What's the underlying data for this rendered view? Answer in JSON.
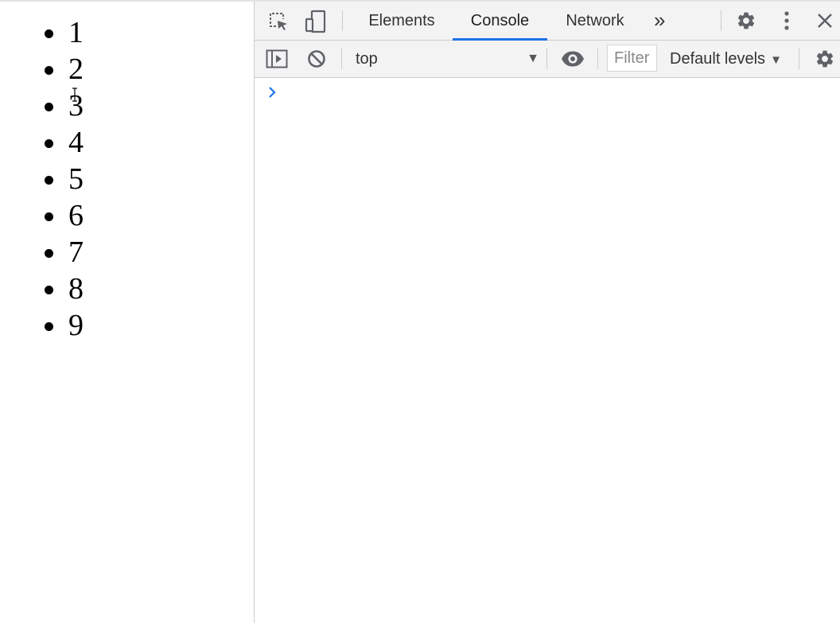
{
  "page": {
    "list_items": [
      "1",
      "2",
      "3",
      "4",
      "5",
      "6",
      "7",
      "8",
      "9"
    ]
  },
  "devtools": {
    "tabs": [
      {
        "label": "Elements",
        "active": false
      },
      {
        "label": "Console",
        "active": true
      },
      {
        "label": "Network",
        "active": false
      }
    ],
    "more_tabs_glyph": "»",
    "toolbar": {
      "context_value": "top",
      "context_arrow": "▼",
      "filter_placeholder": "Filter",
      "levels_label": "Default levels",
      "levels_arrow": "▼"
    },
    "colors": {
      "accent": "#1a73e8",
      "toolbar_bg": "#f3f3f3",
      "prompt": "#1a73e8"
    },
    "icons": [
      "inspect-element-icon",
      "device-toolbar-icon",
      "settings-gear-icon",
      "more-options-icon",
      "close-icon",
      "show-sidebar-icon",
      "clear-console-icon",
      "live-expression-eye-icon",
      "console-settings-gear-icon",
      "console-prompt-icon"
    ]
  }
}
